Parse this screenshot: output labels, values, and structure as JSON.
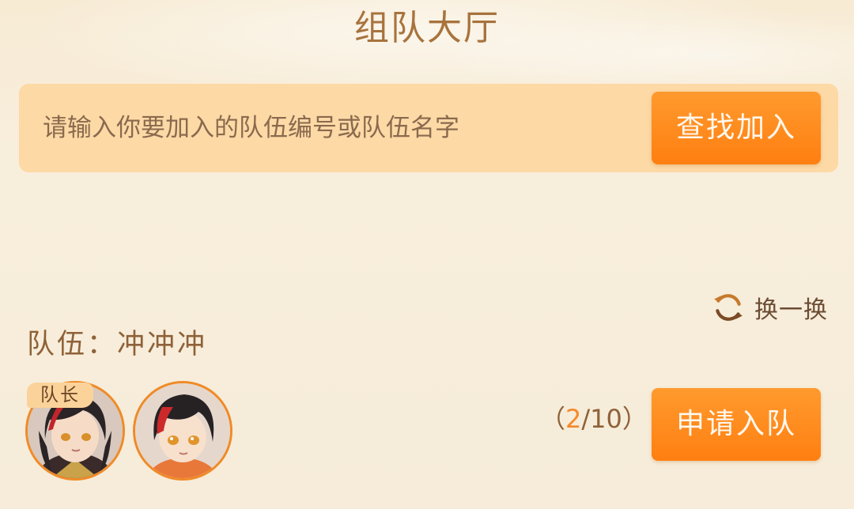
{
  "header": {
    "title": "组队大厅"
  },
  "search": {
    "placeholder": "请输入你要加入的队伍编号或队伍名字",
    "button_label": "查找加入"
  },
  "refresh": {
    "label": "换一换",
    "icon": "refresh-icon"
  },
  "team": {
    "name_label": "队伍：冲冲冲",
    "leader_badge": "队长",
    "members": [
      {
        "role": "leader",
        "avatar": "character-avatar"
      },
      {
        "role": "member",
        "avatar": "character-avatar"
      }
    ],
    "count_open": "（",
    "count_current": "2",
    "count_rest": "/10）",
    "join_label": "申请入队"
  },
  "colors": {
    "accent": "#ff8a1c",
    "title": "#a8733d",
    "search_bg": "#fdd9a6",
    "page_bg": "#f8eedb"
  }
}
